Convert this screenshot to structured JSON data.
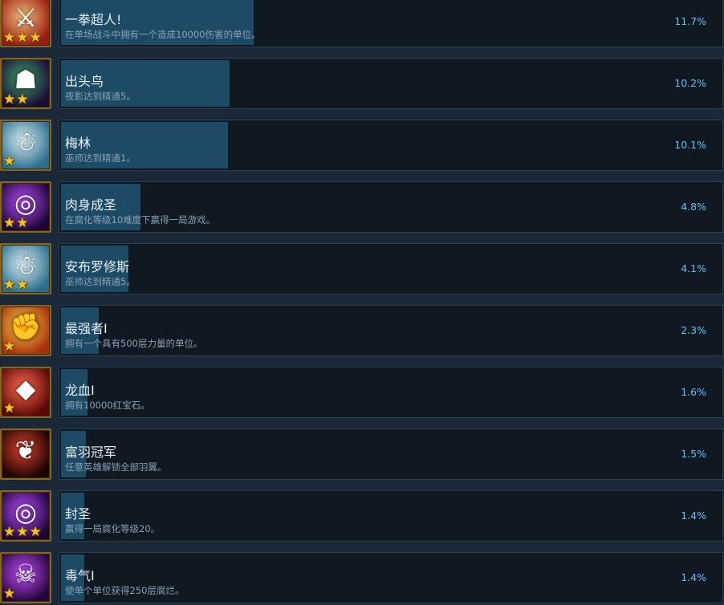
{
  "achievements": [
    {
      "name": "一拳超人!",
      "desc": "在单场战斗中拥有一个造成10000伤害的单位。",
      "percent_text": "11.7%",
      "percent": 11.7,
      "icon": "sword-slash-icon",
      "glyph": "⚔",
      "colors": [
        "#f3c27a",
        "#9a1a12"
      ],
      "stars": 3
    },
    {
      "name": "出头鸟",
      "desc": "夜影达到精通5。",
      "percent_text": "10.2%",
      "percent": 10.2,
      "icon": "hooded-assassin-icon",
      "glyph": "☗",
      "colors": [
        "#3ea36a",
        "#1a0d33"
      ],
      "stars": 2
    },
    {
      "name": "梅林",
      "desc": "巫师达到精通1。",
      "percent_text": "10.1%",
      "percent": 10.1,
      "icon": "white-wizard-icon",
      "glyph": "☃",
      "colors": [
        "#d8eef5",
        "#2c6f8c"
      ],
      "stars": 1
    },
    {
      "name": "肉身成圣",
      "desc": "在腐化等级10难度下赢得一局游戏。",
      "percent_text": "4.8%",
      "percent": 4.8,
      "icon": "corruption-sigil-icon",
      "glyph": "◎",
      "colors": [
        "#b84dff",
        "#1c0533"
      ],
      "stars": 2
    },
    {
      "name": "安布罗修斯",
      "desc": "巫师达到精通5。",
      "percent_text": "4.1%",
      "percent": 4.1,
      "icon": "white-wizard-icon",
      "glyph": "☃",
      "colors": [
        "#d8eef5",
        "#2c6f8c"
      ],
      "stars": 2
    },
    {
      "name": "最强者I",
      "desc": "拥有一个具有500层力量的单位。",
      "percent_text": "2.3%",
      "percent": 2.3,
      "icon": "fist-icon",
      "glyph": "✊",
      "colors": [
        "#ffd24a",
        "#a8320c"
      ],
      "stars": 1
    },
    {
      "name": "龙血I",
      "desc": "拥有10000红宝石。",
      "percent_text": "1.6%",
      "percent": 1.6,
      "icon": "ruby-gem-icon",
      "glyph": "◆",
      "colors": [
        "#ff6a4d",
        "#5a0707"
      ],
      "stars": 1
    },
    {
      "name": "富羽冠军",
      "desc": "任意英雄解锁全部羽翼。",
      "percent_text": "1.5%",
      "percent": 1.5,
      "icon": "dragon-wings-icon",
      "glyph": "❦",
      "colors": [
        "#e0402a",
        "#1a0404"
      ],
      "stars": 0
    },
    {
      "name": "封圣",
      "desc": "赢得一局腐化等级20。",
      "percent_text": "1.4%",
      "percent": 1.4,
      "icon": "corruption-sigil-icon",
      "glyph": "◎",
      "colors": [
        "#b84dff",
        "#1c0533"
      ],
      "stars": 3
    },
    {
      "name": "毒气I",
      "desc": "使单个单位获得250层腐烂。",
      "percent_text": "1.4%",
      "percent": 1.4,
      "icon": "poison-skull-icon",
      "glyph": "☠",
      "colors": [
        "#c04dff",
        "#25063a"
      ],
      "stars": 1
    }
  ]
}
